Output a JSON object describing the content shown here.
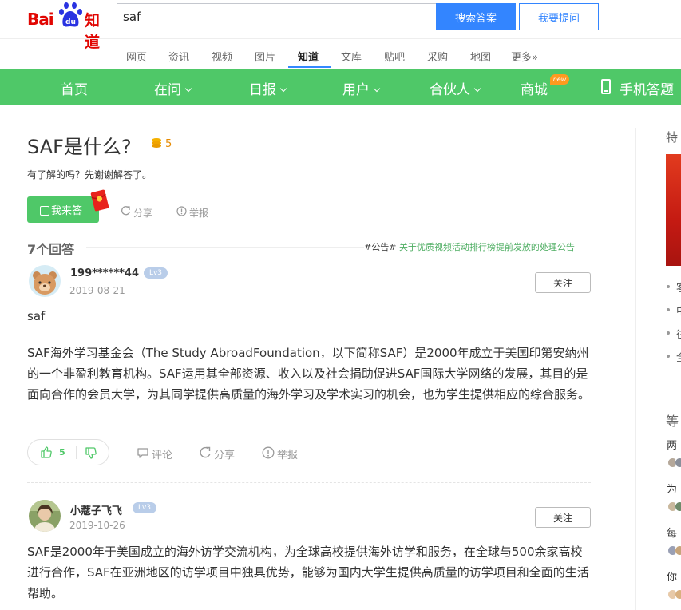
{
  "header": {
    "logo_text_1": "Bai",
    "logo_text_2": "知道",
    "search_value": "saf",
    "search_button": "搜索答案",
    "ask_button": "我要提问"
  },
  "channels": [
    "网页",
    "资讯",
    "视频",
    "图片",
    "知道",
    "文库",
    "贴吧",
    "采购",
    "地图",
    "更多»"
  ],
  "channel_active": "知道",
  "greennav": {
    "home": "首页",
    "zaiwen": "在问",
    "ribao": "日报",
    "yonghu": "用户",
    "huoban": "合伙人",
    "shangcheng": "商城",
    "new_badge": "new",
    "mobile": "手机答题"
  },
  "question": {
    "title": "SAF是什么?",
    "coins": "5",
    "description": "有了解的吗？先谢谢解答了。",
    "answer_button": "我来答",
    "share": "分享",
    "report": "举报"
  },
  "answers_header": {
    "count": "7个回答",
    "notice_tag": "#公告#",
    "notice_link": "关于优质视频活动排行榜提前发放的处理公告"
  },
  "answers": [
    {
      "username": "199******44",
      "level": "Lv3",
      "date": "2019-08-21",
      "follow": "关注",
      "paragraphs": [
        "saf",
        "SAF海外学习基金会（The Study AbroadFoundation，以下简称SAF）是2000年成立于美国印第安纳州的一个非盈利教育机构。SAF运用其全部资源、收入以及社会捐助促进SAF国际大学网络的发展，其目的是面向合作的会员大学，为其同学提供高质量的海外学习及学术实习的机会，也为学生提供相应的综合服务。"
      ],
      "likes": "5",
      "comment": "评论",
      "share": "分享",
      "report": "举报"
    },
    {
      "username": "小蔻子飞飞",
      "level": "Lv3",
      "date": "2019-10-26",
      "follow": "关注",
      "paragraphs": [
        "SAF是2000年于美国成立的海外访学交流机构，为全球高校提供海外访学和服务，在全球与500余家高校进行合作，SAF在亚洲地区的访学项目中独具优势，能够为国内大学生提供高质量的访学项目和全面的生活帮助。"
      ]
    }
  ],
  "sidebar": {
    "heading_1": "特",
    "heading_2": "等",
    "item_1": "两",
    "item_2": "为",
    "item_3": "每",
    "item_4": "你",
    "bullets": [
      "客",
      "中",
      "往",
      "全"
    ]
  },
  "colors": {
    "brand_red": "#e10602",
    "search_blue": "#3385ff",
    "nav_green": "#4fc868",
    "coin_orange": "#e68a00"
  }
}
